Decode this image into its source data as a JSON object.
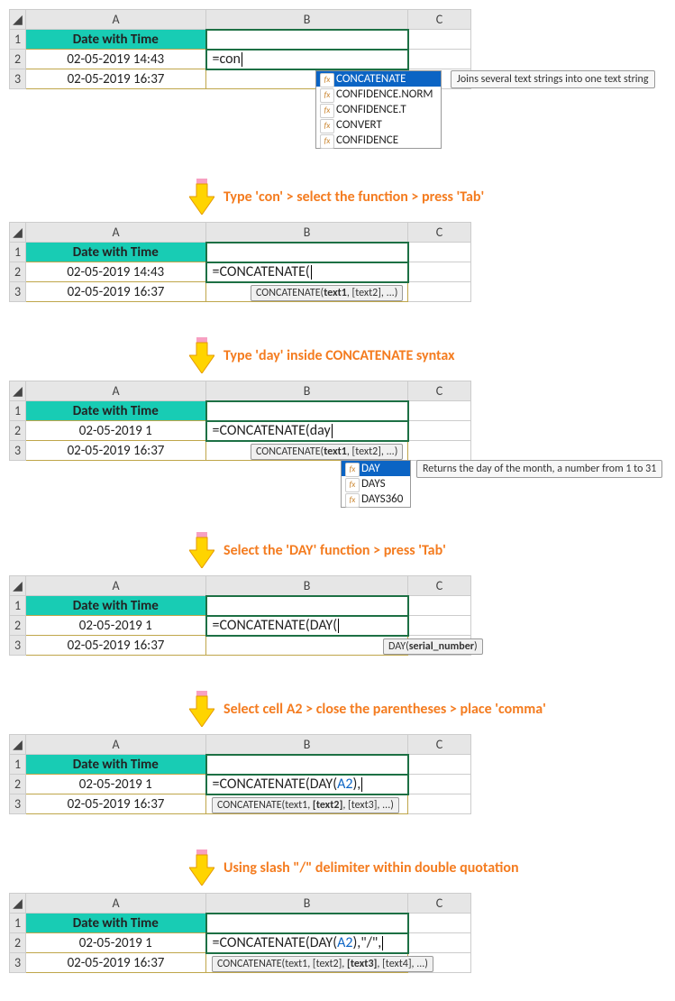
{
  "columns": {
    "A": "A",
    "B": "B",
    "C": "C"
  },
  "rows": {
    "r1": "1",
    "r2": "2",
    "r3": "3"
  },
  "header": "Date with Time",
  "a2_full": "02-05-2019 14:43",
  "a2_trunc": "02-05-2019 1",
  "a3": "02-05-2019 16:37",
  "s1": {
    "formula": "=con",
    "suggest": [
      "CONCATENATE",
      "CONFIDENCE.NORM",
      "CONFIDENCE.T",
      "CONVERT",
      "CONFIDENCE"
    ],
    "tooltip": "Joins several text strings into one text string",
    "step_text": "Type 'con' > select the function > press 'Tab'"
  },
  "s2": {
    "formula": "=CONCATENATE(",
    "syntax_pre": "CONCATENATE(",
    "syntax_bold": "text1",
    "syntax_post": ", [text2], ...)",
    "step_text": "Type 'day' inside CONCATENATE syntax"
  },
  "s3": {
    "formula_pre": "=CONCATENATE(day",
    "syntax_pre": "CONCATENATE(",
    "syntax_bold": "text1",
    "syntax_post": ", [text2], ...)",
    "suggest": [
      "DAY",
      "DAYS",
      "DAYS360"
    ],
    "tooltip": "Returns the day of the month, a number from 1 to 31",
    "step_text": "Select the 'DAY' function > press 'Tab'"
  },
  "s4": {
    "formula_plain": "=CONCATENATE(DAY(",
    "syntax_pre": "DAY(",
    "syntax_bold": "serial_number",
    "syntax_post": ")",
    "step_text": "Select cell A2 > close the parentheses > place 'comma'"
  },
  "s5": {
    "formula_pre": "=CONCATENATE(DAY(",
    "formula_ref": "A2",
    "formula_post": "),",
    "syntax_pre": "CONCATENATE(text1, ",
    "syntax_bold": "[text2]",
    "syntax_post": ", [text3], ...)",
    "step_text": "Using slash \"/\" delimiter within double quotation"
  },
  "s6": {
    "formula_pre": "=CONCATENATE(DAY(",
    "formula_ref": "A2",
    "formula_post": "),\"/\",",
    "syntax_pre": "CONCATENATE(text1, [text2], ",
    "syntax_bold": "[text3]",
    "syntax_post": ", [text4], ...)"
  }
}
